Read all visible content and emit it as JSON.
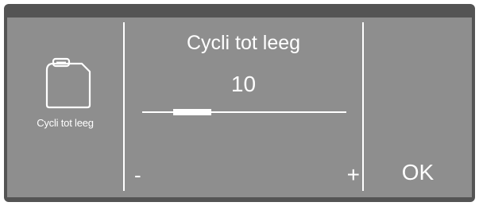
{
  "left_panel": {
    "icon": "canister-icon",
    "label": "Cycli tot leeg"
  },
  "main": {
    "title": "Cycli tot leeg",
    "value": "10",
    "slider_level": 0.245
  },
  "controls": {
    "minus_label": "-",
    "plus_label": "+",
    "ok_label": "OK"
  },
  "colors": {
    "screen_background": "#8e8e8e",
    "frame": "#545454",
    "foreground": "#ffffff"
  }
}
